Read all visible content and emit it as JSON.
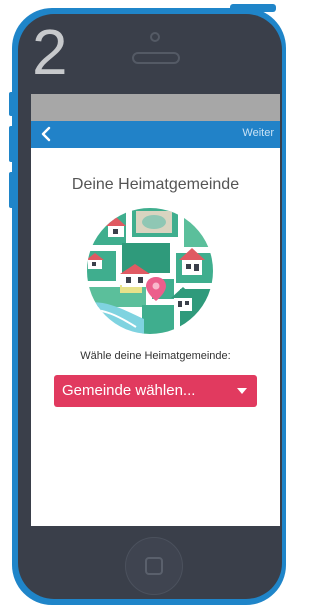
{
  "step_number": "2",
  "header": {
    "back_icon": "chevron-left-icon",
    "next_label": "Weiter"
  },
  "main": {
    "title": "Deine Heimatgemeinde",
    "illustration": "village-map-illustration",
    "prompt": "Wähle deine Heimatgemeinde:",
    "select": {
      "value": "Gemeinde wählen...",
      "icon": "caret-down-icon"
    }
  },
  "colors": {
    "phone_frame": "#1f85c9",
    "nav_bar": "#2182c8",
    "select_background": "#e13a5f",
    "status_bar": "#a7a7a7"
  }
}
